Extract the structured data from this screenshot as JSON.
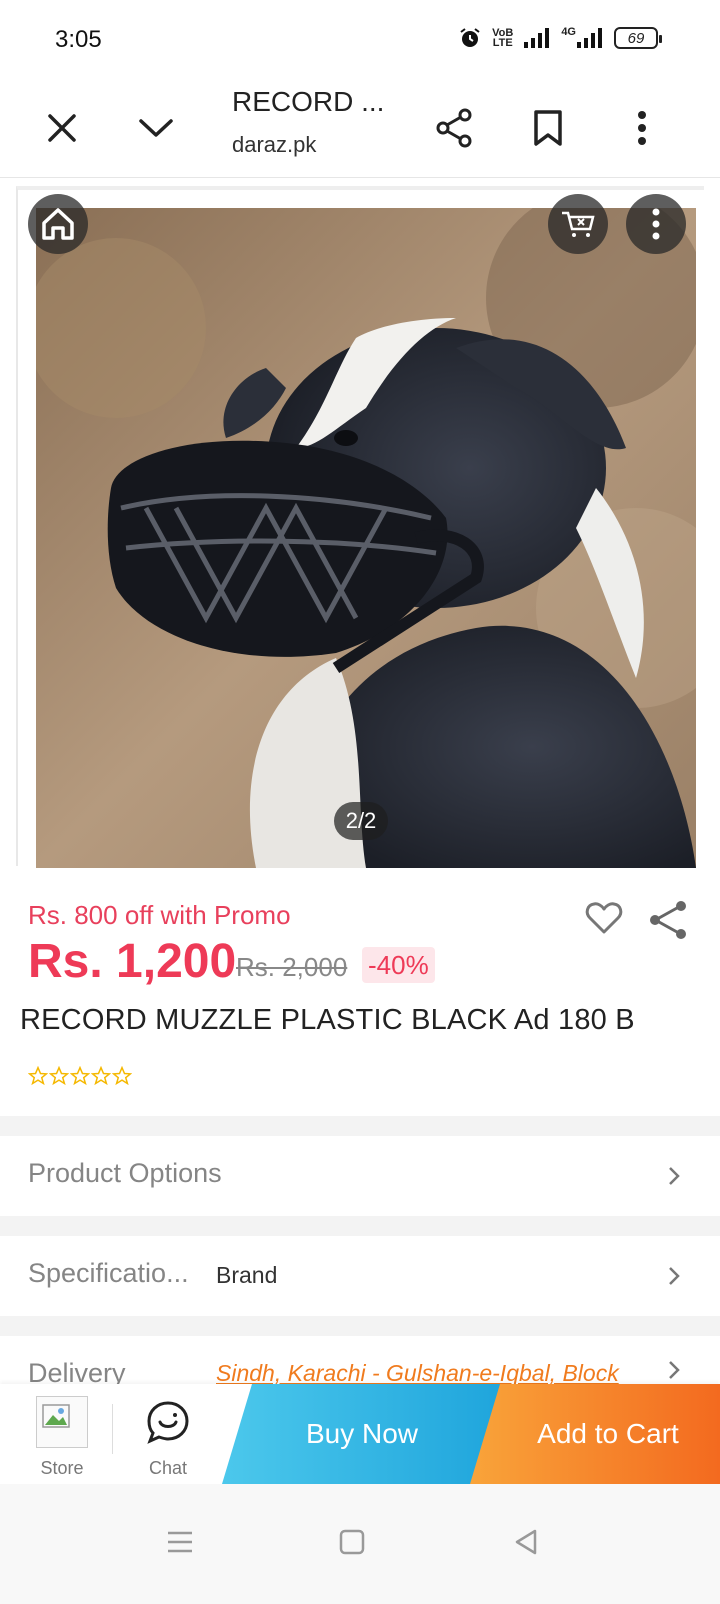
{
  "status": {
    "time": "3:05",
    "net1_top": "VoB",
    "net1_bottom": "LTE",
    "net2": "4G",
    "battery": "69"
  },
  "browser": {
    "title": "RECORD ...",
    "url": "daraz.pk"
  },
  "gallery": {
    "counter": "2/2"
  },
  "product": {
    "promo": "Rs. 800 off with Promo",
    "price": "Rs. 1,200",
    "old_price": "Rs. 2,000",
    "discount": "-40%",
    "title": "RECORD MUZZLE PLASTIC BLACK Ad 180 B",
    "rating": 0,
    "max_rating": 5
  },
  "rows": {
    "options_label": "Product Options",
    "spec_label": "Specificatio...",
    "spec_value": "Brand",
    "delivery_label": "Delivery",
    "delivery_value": "Sindh, Karachi - Gulshan-e-Iqbal, Block"
  },
  "actions": {
    "store": "Store",
    "chat": "Chat",
    "buy_now": "Buy Now",
    "add_to_cart": "Add to Cart"
  },
  "colors": {
    "price_red": "#ee3a57",
    "buy_blue": "#1fa5dc",
    "cart_orange": "#f36a1f",
    "star_gold": "#f5b800"
  },
  "icons": [
    "close-icon",
    "chevron-down-icon",
    "share-icon",
    "bookmark-icon",
    "more-vert-icon",
    "home-icon",
    "cart-icon",
    "heart-icon",
    "chevron-right-icon",
    "chat-icon"
  ]
}
